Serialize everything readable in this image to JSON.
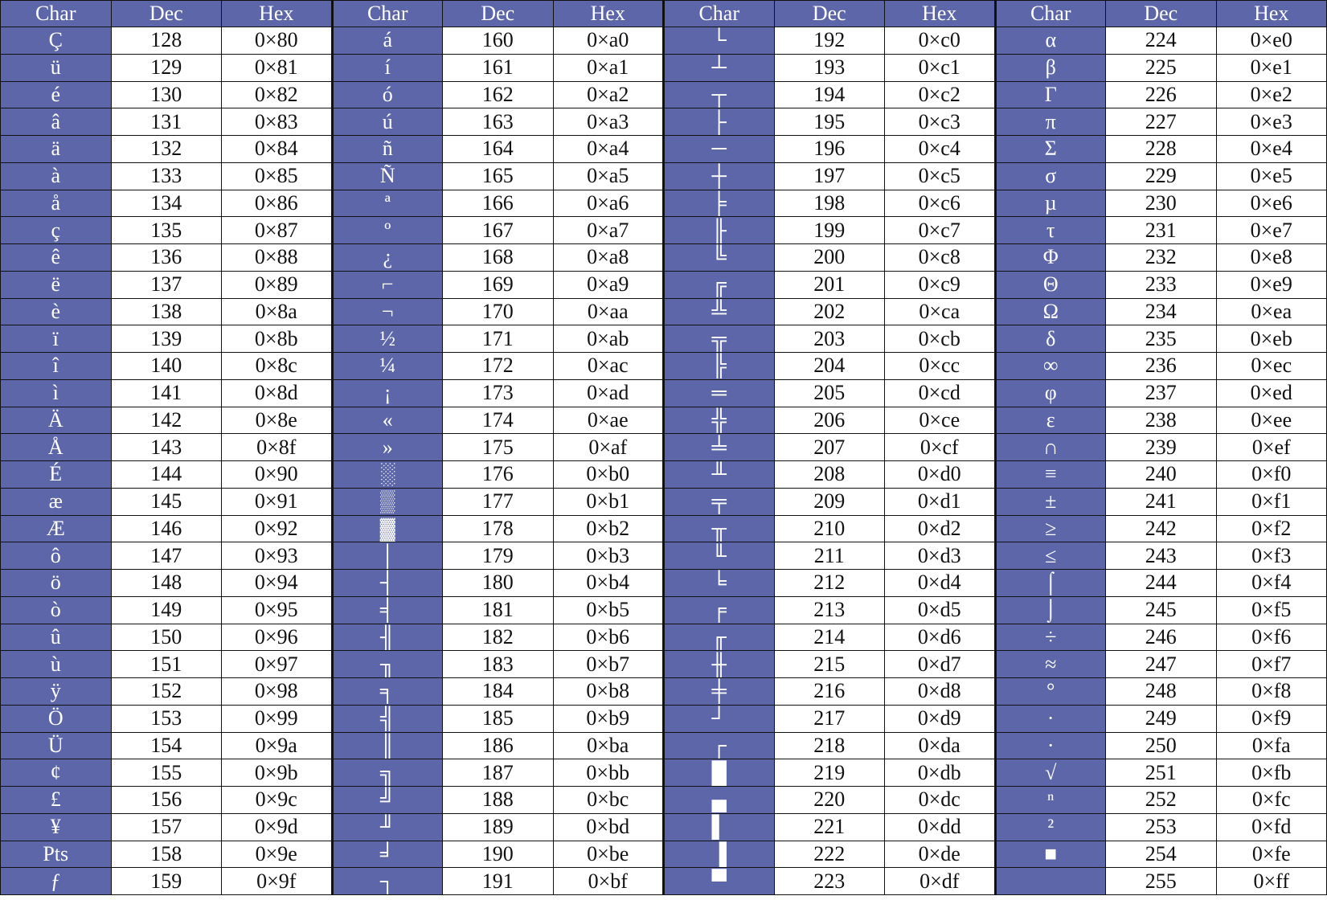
{
  "headers": [
    "Char",
    "Dec",
    "Hex"
  ],
  "colors": {
    "header_bg": "#5d66a8",
    "cell_bg": "#ffffff",
    "text_on_header": "#ffffff"
  },
  "groups": [
    {
      "chars": [
        "Ç",
        "ü",
        "é",
        "â",
        "ä",
        "à",
        "å",
        "ç",
        "ê",
        "ë",
        "è",
        "ï",
        "î",
        "ì",
        "Ä",
        "Å",
        "É",
        "æ",
        "Æ",
        "ô",
        "ö",
        "ò",
        "û",
        "ù",
        "ÿ",
        "Ö",
        "Ü",
        "¢",
        "£",
        "¥",
        "Pts",
        "ƒ"
      ],
      "dec": [
        "128",
        "129",
        "130",
        "131",
        "132",
        "133",
        "134",
        "135",
        "136",
        "137",
        "138",
        "139",
        "140",
        "141",
        "142",
        "143",
        "144",
        "145",
        "146",
        "147",
        "148",
        "149",
        "150",
        "151",
        "152",
        "153",
        "154",
        "155",
        "156",
        "157",
        "158",
        "159"
      ],
      "hex": [
        "0×80",
        "0×81",
        "0×82",
        "0×83",
        "0×84",
        "0×85",
        "0×86",
        "0×87",
        "0×88",
        "0×89",
        "0×8a",
        "0×8b",
        "0×8c",
        "0×8d",
        "0×8e",
        "0×8f",
        "0×90",
        "0×91",
        "0×92",
        "0×93",
        "0×94",
        "0×95",
        "0×96",
        "0×97",
        "0×98",
        "0×99",
        "0×9a",
        "0×9b",
        "0×9c",
        "0×9d",
        "0×9e",
        "0×9f"
      ]
    },
    {
      "chars": [
        "á",
        "í",
        "ó",
        "ú",
        "ñ",
        "Ñ",
        "ª",
        "º",
        "¿",
        "⌐",
        "¬",
        "½",
        "¼",
        "¡",
        "«",
        "»",
        "░",
        "▒",
        "▓",
        "│",
        "┤",
        "╡",
        "╢",
        "╖",
        "╕",
        "╣",
        "║",
        "╗",
        "╝",
        "╜",
        "╛",
        "┐"
      ],
      "dec": [
        "160",
        "161",
        "162",
        "163",
        "164",
        "165",
        "166",
        "167",
        "168",
        "169",
        "170",
        "171",
        "172",
        "173",
        "174",
        "175",
        "176",
        "177",
        "178",
        "179",
        "180",
        "181",
        "182",
        "183",
        "184",
        "185",
        "186",
        "187",
        "188",
        "189",
        "190",
        "191"
      ],
      "hex": [
        "0×a0",
        "0×a1",
        "0×a2",
        "0×a3",
        "0×a4",
        "0×a5",
        "0×a6",
        "0×a7",
        "0×a8",
        "0×a9",
        "0×aa",
        "0×ab",
        "0×ac",
        "0×ad",
        "0×ae",
        "0×af",
        "0×b0",
        "0×b1",
        "0×b2",
        "0×b3",
        "0×b4",
        "0×b5",
        "0×b6",
        "0×b7",
        "0×b8",
        "0×b9",
        "0×ba",
        "0×bb",
        "0×bc",
        "0×bd",
        "0×be",
        "0×bf"
      ]
    },
    {
      "chars": [
        "└",
        "┴",
        "┬",
        "├",
        "─",
        "┼",
        "╞",
        "╟",
        "╚",
        "╔",
        "╩",
        "╦",
        "╠",
        "═",
        "╬",
        "╧",
        "╨",
        "╤",
        "╥",
        "╙",
        "╘",
        "╒",
        "╓",
        "╫",
        "╪",
        "┘",
        "┌",
        "█",
        "▄",
        "▌",
        "▐",
        "▀"
      ],
      "dec": [
        "192",
        "193",
        "194",
        "195",
        "196",
        "197",
        "198",
        "199",
        "200",
        "201",
        "202",
        "203",
        "204",
        "205",
        "206",
        "207",
        "208",
        "209",
        "210",
        "211",
        "212",
        "213",
        "214",
        "215",
        "216",
        "217",
        "218",
        "219",
        "220",
        "221",
        "222",
        "223"
      ],
      "hex": [
        "0×c0",
        "0×c1",
        "0×c2",
        "0×c3",
        "0×c4",
        "0×c5",
        "0×c6",
        "0×c7",
        "0×c8",
        "0×c9",
        "0×ca",
        "0×cb",
        "0×cc",
        "0×cd",
        "0×ce",
        "0×cf",
        "0×d0",
        "0×d1",
        "0×d2",
        "0×d3",
        "0×d4",
        "0×d5",
        "0×d6",
        "0×d7",
        "0×d8",
        "0×d9",
        "0×da",
        "0×db",
        "0×dc",
        "0×dd",
        "0×de",
        "0×df"
      ]
    },
    {
      "chars": [
        "α",
        "β",
        "Γ",
        "π",
        "Σ",
        "σ",
        "µ",
        "τ",
        "Φ",
        "Θ",
        "Ω",
        "δ",
        "∞",
        "φ",
        "ε",
        "∩",
        "≡",
        "±",
        "≥",
        "≤",
        "⌠",
        "⌡",
        "÷",
        "≈",
        "°",
        "∙",
        "·",
        "√",
        "ⁿ",
        "²",
        "■",
        " "
      ],
      "dec": [
        "224",
        "225",
        "226",
        "227",
        "228",
        "229",
        "230",
        "231",
        "232",
        "233",
        "234",
        "235",
        "236",
        "237",
        "238",
        "239",
        "240",
        "241",
        "242",
        "243",
        "244",
        "245",
        "246",
        "247",
        "248",
        "249",
        "250",
        "251",
        "252",
        "253",
        "254",
        "255"
      ],
      "hex": [
        "0×e0",
        "0×e1",
        "0×e2",
        "0×e3",
        "0×e4",
        "0×e5",
        "0×e6",
        "0×e7",
        "0×e8",
        "0×e9",
        "0×ea",
        "0×eb",
        "0×ec",
        "0×ed",
        "0×ee",
        "0×ef",
        "0×f0",
        "0×f1",
        "0×f2",
        "0×f3",
        "0×f4",
        "0×f5",
        "0×f6",
        "0×f7",
        "0×f8",
        "0×f9",
        "0×fa",
        "0×fb",
        "0×fc",
        "0×fd",
        "0×fe",
        "0×ff"
      ]
    }
  ]
}
